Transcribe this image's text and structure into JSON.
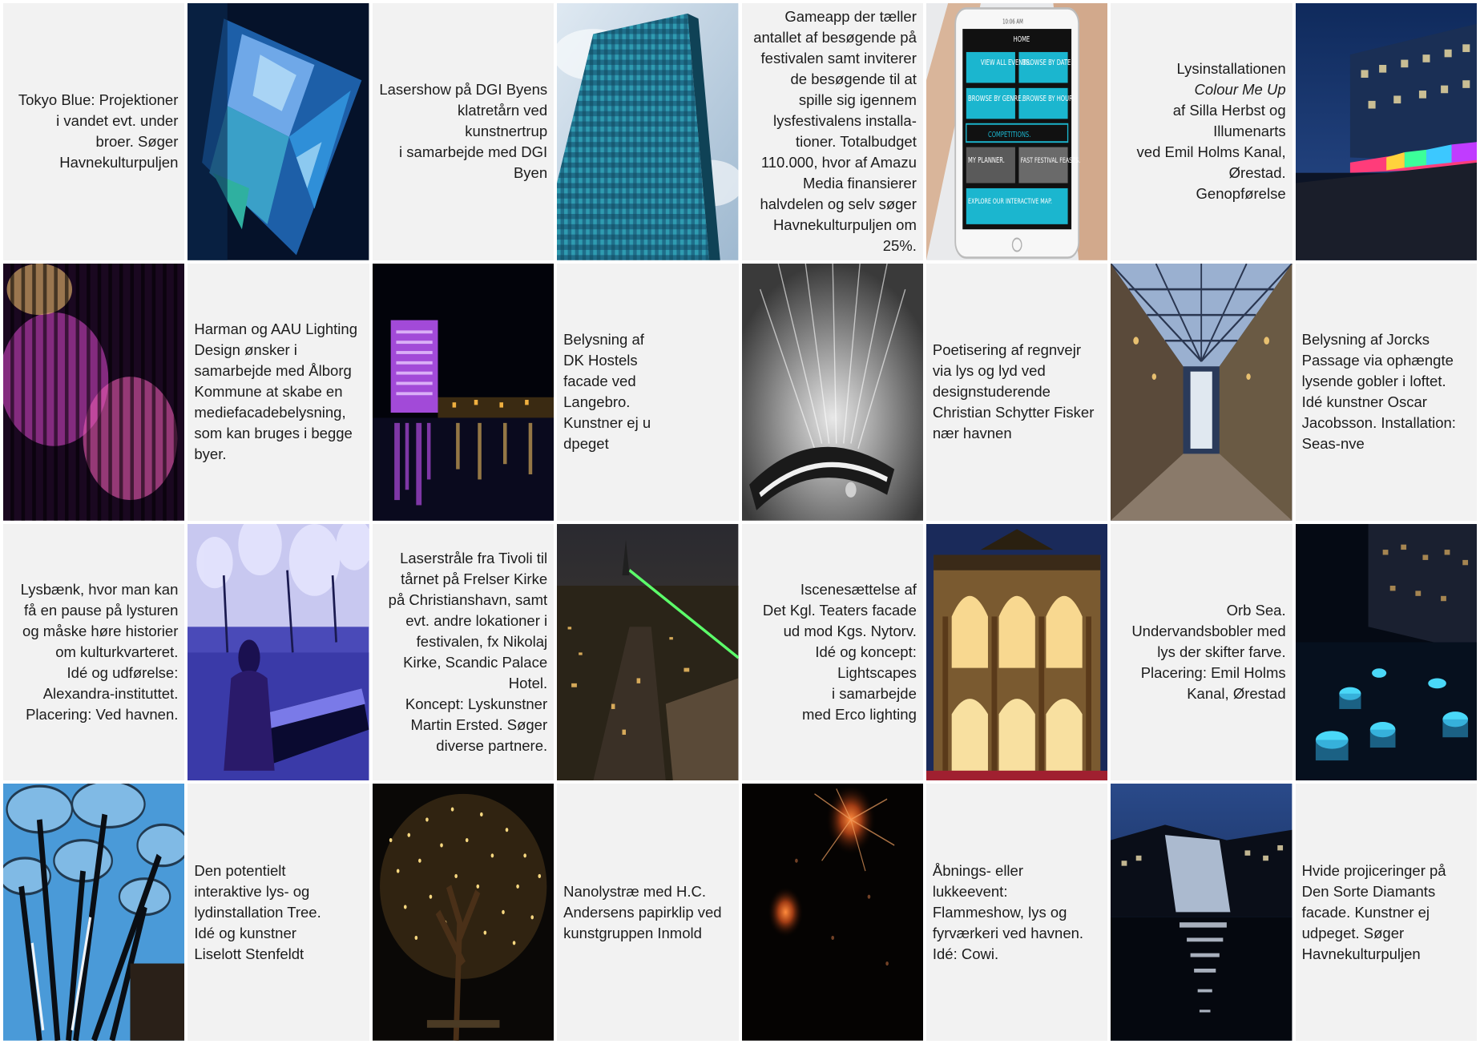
{
  "captions": {
    "tokyo_blue": "Tokyo Blue: Projektioner\ni vandet evt. under\nbroer. Søger\nHavnekulturpuljen",
    "lasershow": "Lasershow på DGI Byens\nklatretårn ved\nkunstnertrup\ni samarbejde med DGI\nByen",
    "gameapp": "Gameapp der tæller\nantallet af besøgende på\nfestivalen samt inviterer\nde besøgende til at\nspille sig igennem\nlysfestivalens installa-\ntioner. Totalbudget\n110.000, hvor af Amazu\nMedia finansierer\nhalvdelen og selv søger\nHavnekulturpuljen om\n25%.",
    "colour_me_up_pre": "Lysinstallationen",
    "colour_me_up_title": "Colour Me Up",
    "colour_me_up_post": "af Silla Herbst og\nIllumenarts\nved Emil Holms Kanal,\nØrestad.\nGenopførelse",
    "harman": "Harman og AAU Lighting\nDesign ønsker i\nsamarbejde med Ålborg\nKommune at skabe en\nmediefacadebelysning,\nsom kan bruges i begge\nbyer.",
    "dk_hostels": "Belysning af\nDK Hostels\nfacade ved\nLangebro.\nKunstner ej u\ndpeget",
    "regnvejr": "Poetisering af regnvejr\nvia lys og lyd ved\ndesignstuderende\nChristian Schytter Fisker\nnær havnen",
    "jorcks": "Belysning af Jorcks\nPassage via ophængte\nlysende gobler i loftet.\nIdé kunstner Oscar\nJacobsson. Installation:\nSeas-nve",
    "lysbaenk": "Lysbænk, hvor man kan\nfå en pause på lysturen\nog måske høre historier\nom kulturkvarteret.\nIdé og udførelse:\nAlexandra-instituttet.\nPlacering: Ved havnen.",
    "tivoli": "Laserstråle fra Tivoli til\ntårnet på Frelser Kirke\npå Christianshavn, samt\nevt. andre lokationer i\nfestivalen, fx Nikolaj\nKirke, Scandic Palace\nHotel.\nKoncept: Lyskunstner\nMartin Ersted. Søger\ndiverse partnere.",
    "kgl_teater": "Iscenesættelse af\nDet Kgl. Teaters facade\nud mod Kgs. Nytorv.\nIdé og koncept:\nLightscapes\ni samarbejde\nmed Erco lighting",
    "orb_sea": "Orb Sea.\nUndervandsbobler med\nlys der skifter farve.\nPlacering: Emil Holms\nKanal, Ørestad",
    "tree": "Den potentielt\ninteraktive lys- og\nlydinstallation Tree.\nIdé og kunstner\nLiselott Stenfeldt",
    "nanolystrae": "Nanolystræ med H.C.\nAndersens papirklip ved\nkunstgruppen Inmold",
    "aabning": "Åbnings- eller\nlukkeevent:\nFlammeshow, lys og\nfyrværkeri ved havnen.\nIdé: Cowi.",
    "sorte_diamant": "Hvide projiceringer på\nDen Sorte Diamants\nfacade. Kunstner ej\nudpeget. Søger\nHavnekulturpuljen"
  },
  "phone_app": {
    "time": "10:06 AM",
    "home": "HOME",
    "tiles": [
      "VIEW ALL EVENTS.",
      "BROWSE BY DATE.",
      "BROWSE BY GENRE.",
      "BROWSE BY HOUR.",
      "COMPETITIONS.",
      "MY PLANNER.",
      "FAST FESTIVAL FEASTS.",
      "EXPLORE OUR INTERACTIVE MAP."
    ]
  }
}
